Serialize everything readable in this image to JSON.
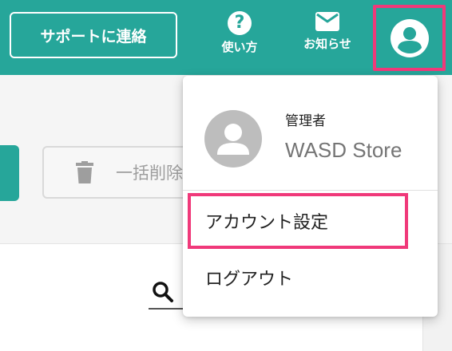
{
  "header": {
    "support_label": "サポートに連絡",
    "help_label": "使い方",
    "help_icon_glyph": "?",
    "notice_label": "お知らせ",
    "accent": "#26a69a"
  },
  "toolbar": {
    "bulk_delete_label": "一括削除"
  },
  "dropdown": {
    "role": "管理者",
    "store_name": "WASD Store",
    "items": [
      {
        "label": "アカウント設定",
        "highlighted": true
      },
      {
        "label": "ログアウト",
        "highlighted": false
      }
    ],
    "highlight_color": "#f0397a"
  },
  "icons": [
    "help-icon",
    "mail-icon",
    "account-circle-icon",
    "person-icon",
    "trash-icon",
    "search-icon"
  ]
}
